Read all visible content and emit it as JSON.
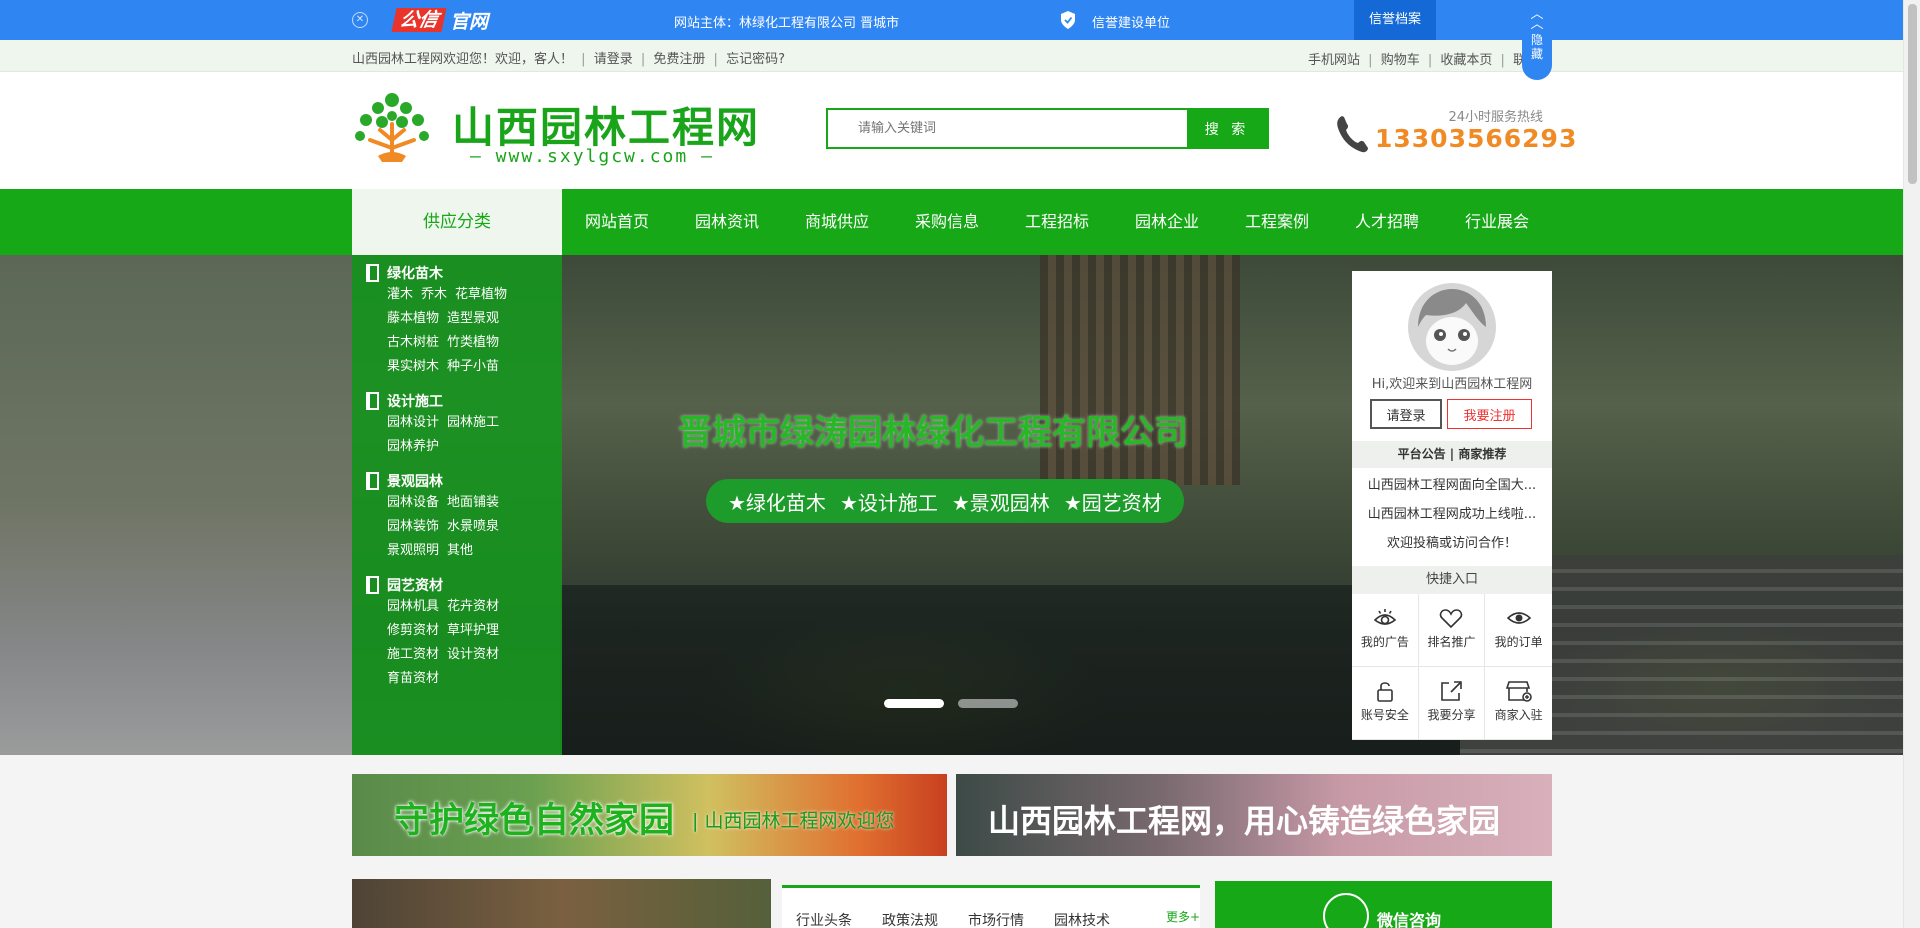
{
  "gongxin": {
    "logo_a": "公信",
    "logo_b": "官网",
    "subject": "网站主体：林绿化工程有限公司  晋城市",
    "credit": "信誉建设单位",
    "archive": "信誉档案",
    "hide": "隐藏"
  },
  "login_bar": {
    "welcome": "山西园林工程网欢迎您！欢迎，客人！",
    "login": "请登录",
    "register": "免费注册",
    "forgot": "忘记密码?",
    "links": [
      "手机网站",
      "购物车",
      "收藏本页",
      "联系"
    ]
  },
  "header": {
    "site_title": "山西园林工程网",
    "site_url": "— www.sxylgcw.com —",
    "search_placeholder": "请输入关键词",
    "search_button": "搜 索",
    "hotline_label": "24小时服务热线",
    "hotline_number": "13303566293"
  },
  "nav": {
    "category": "供应分类",
    "items": [
      "网站首页",
      "园林资讯",
      "商城供应",
      "采购信息",
      "工程招标",
      "园林企业",
      "工程案例",
      "人才招聘",
      "行业展会"
    ]
  },
  "categories": [
    {
      "title": "绿化苗木",
      "subs": [
        [
          "灌木",
          "乔木",
          "花草植物"
        ],
        [
          "藤本植物",
          "造型景观"
        ],
        [
          "古木树桩",
          "竹类植物"
        ],
        [
          "果实树木",
          "种子小苗"
        ]
      ]
    },
    {
      "title": "设计施工",
      "subs": [
        [
          "园林设计",
          "园林施工"
        ],
        [
          "园林养护"
        ]
      ]
    },
    {
      "title": "景观园林",
      "subs": [
        [
          "园林设备",
          "地面铺装"
        ],
        [
          "园林装饰",
          "水景喷泉"
        ],
        [
          "景观照明",
          "其他"
        ]
      ]
    },
    {
      "title": "园艺资材",
      "subs": [
        [
          "园林机具",
          "花卉资材"
        ],
        [
          "修剪资材",
          "草坪护理"
        ],
        [
          "施工资材",
          "设计资材"
        ],
        [
          "育苗资材"
        ]
      ]
    }
  ],
  "banner": {
    "title": "晋城市绿涛园林绿化工程有限公司",
    "tags": [
      "★绿化苗木",
      "★设计施工",
      "★景观园林",
      "★园艺资材"
    ]
  },
  "user_panel": {
    "welcome": "Hi,欢迎来到山西园林工程网",
    "login": "请登录",
    "register": "我要注册",
    "tabs": "平台公告 | 商家推荐",
    "notices": [
      "山西园林工程网面向全国大...",
      "山西园林工程网成功上线啦...",
      "欢迎投稿或访问合作！"
    ],
    "quick_title": "快捷入口",
    "quick": [
      {
        "label": "我的广告",
        "icon": "ad-eye-icon"
      },
      {
        "label": "排名推广",
        "icon": "heart-icon"
      },
      {
        "label": "我的订单",
        "icon": "eye-icon"
      },
      {
        "label": "账号安全",
        "icon": "lock-icon"
      },
      {
        "label": "我要分享",
        "icon": "share-icon"
      },
      {
        "label": "商家入驻",
        "icon": "store-icon"
      }
    ]
  },
  "ads": {
    "ad1_main": "守护绿色自然家园",
    "ad1_sub": "| 山西园林工程网欢迎您",
    "ad2_main": "山西园林工程网，用心铸造绿色家园"
  },
  "news": {
    "tabs": [
      "行业头条",
      "政策法规",
      "市场行情",
      "园林技术"
    ],
    "more": "更多+"
  },
  "wechat": {
    "label": "微信咨询"
  },
  "colors": {
    "brand_green": "#17a817",
    "top_blue": "#2f86f3",
    "hotline_orange": "#f08a24"
  }
}
